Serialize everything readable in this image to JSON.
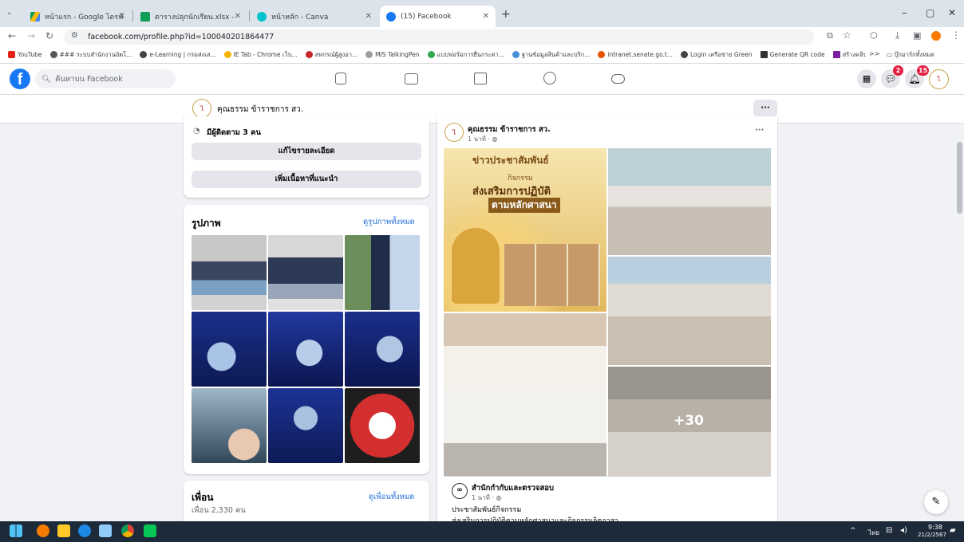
{
  "browser": {
    "tabs": [
      {
        "title": "หน้าแรก - Google ไดรฟ์",
        "active": false
      },
      {
        "title": "ตารางปลุกนักเรียน.xlsx - Google ชีต",
        "active": false
      },
      {
        "title": "หน้าหลัก - Canva",
        "active": false
      },
      {
        "title": "(15) Facebook",
        "active": true
      }
    ],
    "url": "facebook.com/profile.php?id=100040201864477",
    "bookmarks": [
      "YouTube",
      "### ระบบสำนักงานอัตโ...",
      "e-Learning | กรมส่งเส...",
      "IE Tab - Chrome เว็บ...",
      "สหกรณ์ผู้สูงอา...",
      "MIS TalkingPen",
      "แบบฟอร์มการยื่นกระดา...",
      "ฐานข้อมูลสินค้าและบริก...",
      "intranet.senate.go.t...",
      "Login เครือข่าย Green",
      "Generate QR code",
      "สร้างคลิป QR ฟรี | สร้า..."
    ],
    "bookmarks_folder": "บุ๊กมาร์กทั้งหมด",
    "more": ">>"
  },
  "facebook": {
    "search_placeholder": "ค้นหาบน Facebook",
    "messenger_badge": "2",
    "notif_badge": "15",
    "profile_name": "คุณธรรม ข้าราชการ สว.",
    "more_button": "···"
  },
  "left": {
    "followers": "มีผู้ติดตาม 3 คน",
    "edit_details": "แก้ไขรายละเอียด",
    "add_featured": "เพิ่มเนื้อหาที่แนะนำ",
    "photos_title": "รูปภาพ",
    "see_all_photos": "ดูรูปภาพทั้งหมด",
    "friends_title": "เพื่อน",
    "friends_count": "เพื่อน 2,330 คน",
    "see_all_friends": "ดูเพื่อนทั้งหมด"
  },
  "post": {
    "author": "คุณธรรม ข้าราชการ สว.",
    "time": "1 นาที · ",
    "menu": "···",
    "banner_title": "ข่าวประชาสัมพันธ์",
    "banner_sub1": "กิจกรรม",
    "banner_sub2": "ส่งเสริมการปฏิบัติ",
    "banner_sub3": "ตามหลักศาสนา",
    "extra_photos": "+30",
    "shared_author": "สำนักกำกับและตรวจสอบ",
    "shared_time": "1 นาที · ",
    "shared_line1": "ประชาสัมพันธ์กิจกรรม",
    "shared_line2": "ส่งเสริมการปฏิบัติตามหลักศาสนาและกิจกรรมจิตอาสา"
  },
  "taskbar": {
    "lang": "ไทย",
    "time": "9:38",
    "date": "21/2/2567"
  },
  "window_controls": [
    "–",
    "▢",
    "✕"
  ]
}
